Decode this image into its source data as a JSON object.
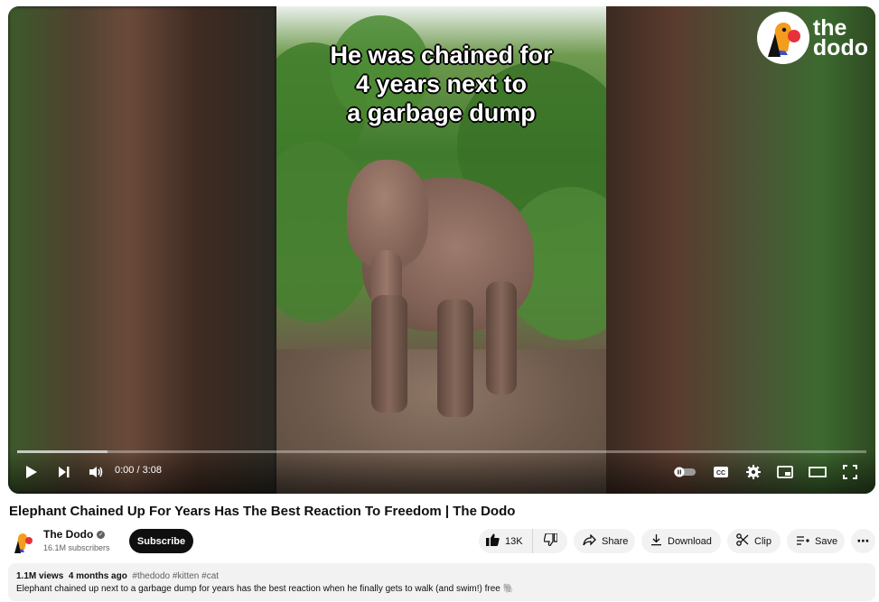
{
  "video": {
    "overlay_lines": [
      "He was chained for",
      "4 years next to",
      "a garbage dump"
    ],
    "logo_line1": "the",
    "logo_line2": "dodo",
    "time_display": "0:00 / 3:08",
    "progress_fraction": 0
  },
  "title": "Elephant Chained Up For Years Has The Best Reaction To Freedom | The Dodo",
  "channel": {
    "name": "The Dodo",
    "subscribers": "16.1M subscribers",
    "subscribe_label": "Subscribe"
  },
  "actions": {
    "likes": "13K",
    "share": "Share",
    "download": "Download",
    "clip": "Clip",
    "save": "Save"
  },
  "description": {
    "views": "1.1M views",
    "age": "4 months ago",
    "tags": "#thedodo #kitten #cat",
    "text": "Elephant chained up next to a garbage dump for years has the best reaction when he finally gets to walk (and swim!) free 🐘"
  },
  "icons": [
    "play-icon",
    "next-icon",
    "volume-icon",
    "autoplay-toggle-icon",
    "captions-icon",
    "settings-icon",
    "miniplayer-icon",
    "theater-icon",
    "fullscreen-icon",
    "like-icon",
    "dislike-icon",
    "share-icon",
    "download-icon",
    "clip-icon",
    "save-icon",
    "more-icon",
    "verified-icon"
  ],
  "colors": {
    "subscribe_bg": "#0f0f0f",
    "pill_bg": "#f2f2f2",
    "dodo_red": "#e8313b",
    "dodo_blue": "#3b50c9",
    "dodo_orange": "#f39c1e"
  }
}
